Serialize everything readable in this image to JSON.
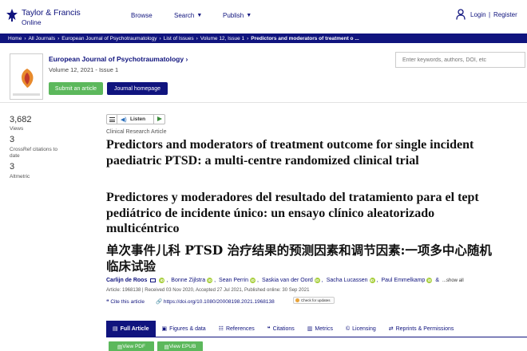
{
  "header": {
    "brand_line1": "Taylor & Francis",
    "brand_line2": "Online",
    "nav": [
      "Browse",
      "Search",
      "Publish"
    ],
    "login": "Login",
    "separator": "|",
    "register": "Register"
  },
  "breadcrumb": [
    "Home",
    "All Journals",
    "European Journal of Psychotraumatology",
    "List of Issues",
    "Volume 12, Issue 1",
    "Predictors and moderators of treatment o ..."
  ],
  "journal": {
    "title": "European Journal of Psychotraumatology",
    "volume": "Volume 12, 2021 - Issue 1",
    "submit_label": "Submit an article",
    "homepage_label": "Journal homepage",
    "search_placeholder": "Enter keywords, authors, DOI, etc"
  },
  "metrics": [
    {
      "value": "3,682",
      "label": "Views"
    },
    {
      "value": "3",
      "label": "CrossRef citations to date"
    },
    {
      "value": "3",
      "label": "Altmetric"
    }
  ],
  "listen": {
    "label": "Listen"
  },
  "article": {
    "category": "Clinical Research Article",
    "title_en": "Predictors and moderators of treatment outcome for single incident paediatric PTSD: a multi-centre randomized clinical trial",
    "title_es": "Predictores y moderadores del resultado del tratamiento para el tept pediátrico de incidente único: un ensayo clínico aleatorizado multicéntrico",
    "title_zh": "单次事件儿科 PTSD 治疗结果的预测因素和调节因素:一项多中心随机临床试验",
    "authors": [
      "Carlijn de Roos",
      "Bonne Zijlstra",
      "Sean Perrin",
      "Saskia van der Oord",
      "Sacha Lucassen",
      "Paul Emmelkamp"
    ],
    "author_tail": "&",
    "show_all": "...show all",
    "meta": "Article: 1968138 | Received 03 Nov 2020, Accepted 27 Jul 2021, Published online: 30 Sep 2021",
    "cite_label": "Cite this article",
    "doi": "https://doi.org/10.1080/20008198.2021.1968138",
    "check_updates": "Check for updates"
  },
  "tabs": [
    "Full Article",
    "Figures & data",
    "References",
    "Citations",
    "Metrics",
    "Licensing",
    "Reprints & Permissions"
  ],
  "downloads": [
    "View PDF",
    "View EPUB"
  ],
  "colors": {
    "brand": "#10147e",
    "green": "#5cb85c",
    "orcid": "#a6ce39"
  }
}
